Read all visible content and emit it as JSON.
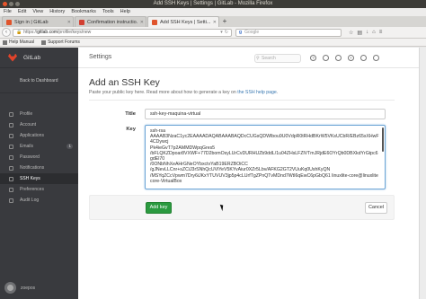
{
  "window": {
    "title": "Add SSH Keys | Settings | GitLab - Mozilla Firefox"
  },
  "menu": [
    "File",
    "Edit",
    "View",
    "History",
    "Bookmarks",
    "Tools",
    "Help"
  ],
  "tabs": [
    {
      "title": "Sign in | GitLab",
      "active": false
    },
    {
      "title": "Confirmation instructio...",
      "active": false
    },
    {
      "title": "Add SSH Keys | Setti...",
      "active": true
    }
  ],
  "address": {
    "prefix": "https://",
    "host": "gitlab.com",
    "path": "/profile/keys/new",
    "search_engine": "g",
    "search_placeholder": "Google"
  },
  "bookmarks": [
    "Help Manual",
    "Support Forums"
  ],
  "sidebar": {
    "brand": "GitLab",
    "back_label": "Back to Dashboard",
    "items": [
      {
        "label": "Profile",
        "icon": "user-icon"
      },
      {
        "label": "Account",
        "icon": "gear-icon"
      },
      {
        "label": "Applications",
        "icon": "cloud-icon"
      },
      {
        "label": "Emails",
        "icon": "envelope-icon",
        "count": "1"
      },
      {
        "label": "Password",
        "icon": "lock-icon"
      },
      {
        "label": "Notifications",
        "icon": "inbox-icon"
      },
      {
        "label": "SSH Keys",
        "icon": "key-icon",
        "active": true
      },
      {
        "label": "Preferences",
        "icon": "image-icon"
      },
      {
        "label": "Audit Log",
        "icon": "history-icon"
      }
    ],
    "username": "zoepos"
  },
  "header": {
    "title": "Settings",
    "search_placeholder": "Search"
  },
  "main": {
    "heading": "Add an SSH Key",
    "intro_text": "Paste your public key here. Read more about how to generate a key on ",
    "intro_link": "the SSH help page",
    "intro_end": ".",
    "title_label": "Title",
    "title_value": "ssh-key-maquina-virtual",
    "key_label": "Key",
    "key_value": "ssh-rsa\nAAAAB3NzaC1yc2EAAAADAQABAAABAQDcCUGsQDWlbou9U0VdpR0tRHdBKrW5VKsUCbR/EBz65sXHwF4CDywcj\nPk4ieGvT7p2AMMDWpqGres5\n/bFLQKZDpoar8VXWF+77D2bomOsyLUrCvDURHUZb9ddL/1u04ZHsLFZlVTmJRjdE6OYrQb0DBXkdYrGtpc6gdEl70\n/0ONbNhXeAHrGNeOYbxctvYaB19ERZBOiCC\n/gJNevLLCnr+sZCiJ3rSNhQcUViYeV5KYvAiur0XZr5Lbv/AFKG2GT2VUuKq0UshKyQN\n/MSYqZCcVpwm7Dry6iJKxYTUVUV3jp5p4cLUrfTgZPnQTvMDnd7WtI6qEwC6pGbQ61 linuxlite-core@linuxlitecore-VirtualBox",
    "add_button": "Add key",
    "cancel_button": "Cancel"
  },
  "colors": {
    "sidebar_bg": "#393a3e",
    "primary_green": "#2b9a40",
    "link": "#3777b0",
    "gitlab_orange": "#e2432a"
  }
}
